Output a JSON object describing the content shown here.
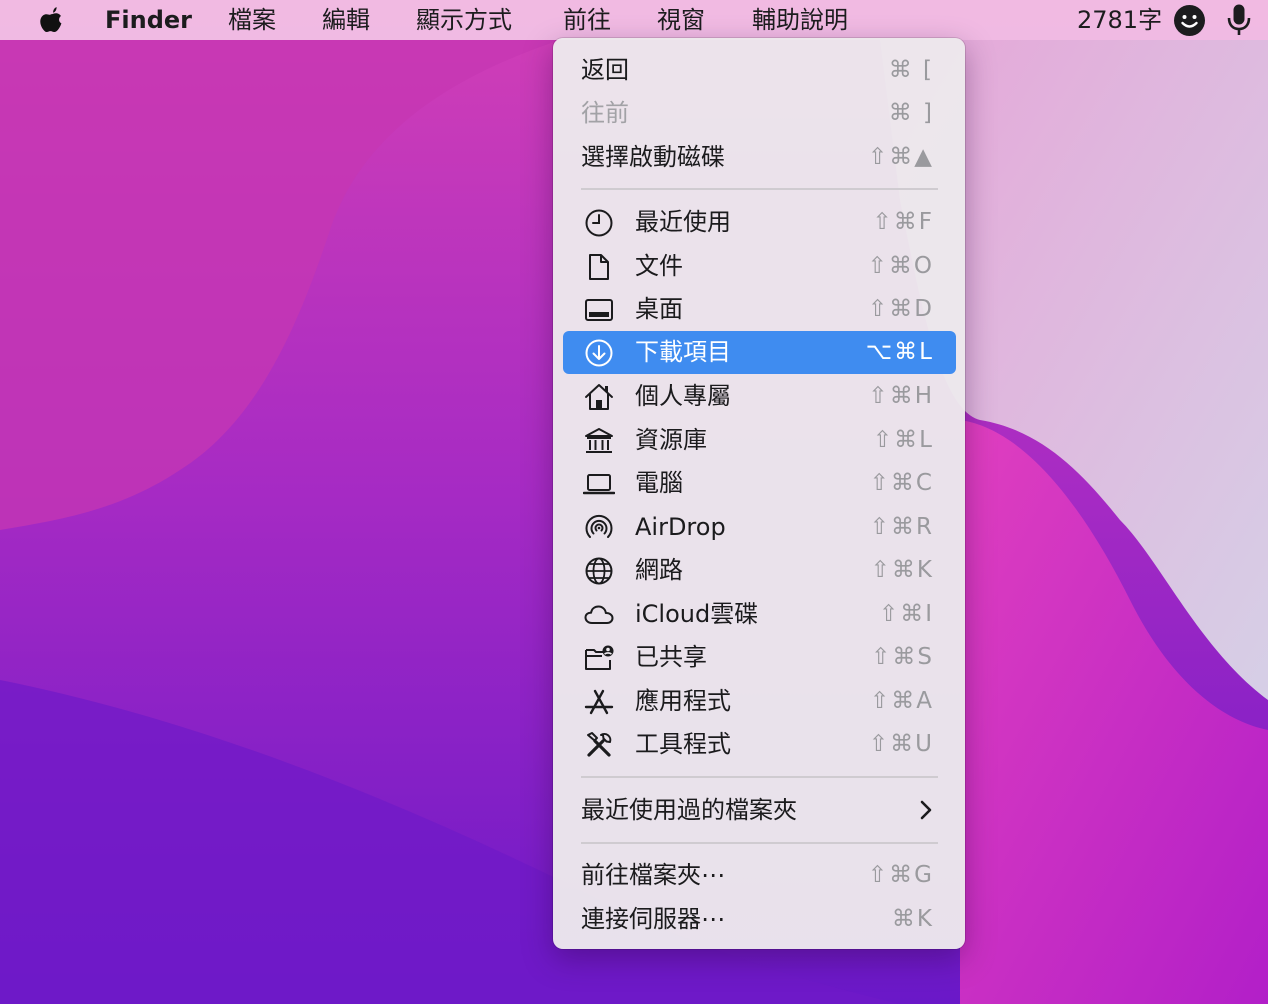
{
  "menubar": {
    "app_name": "Finder",
    "menus": [
      "檔案",
      "編輯",
      "顯示方式",
      "前往",
      "視窗",
      "輔助說明"
    ],
    "status_text": "2781字"
  },
  "go_menu": {
    "top_items": [
      {
        "label": "返回",
        "shortcut": "⌘ [",
        "disabled": false
      },
      {
        "label": "往前",
        "shortcut": "⌘ ]",
        "disabled": true
      },
      {
        "label": "選擇啟動磁碟",
        "shortcut": "⇧⌘▲",
        "disabled": false
      }
    ],
    "locations": [
      {
        "label": "最近使用",
        "shortcut": "⇧⌘F",
        "icon": "clock-icon"
      },
      {
        "label": "文件",
        "shortcut": "⇧⌘O",
        "icon": "document-icon"
      },
      {
        "label": "桌面",
        "shortcut": "⇧⌘D",
        "icon": "desktop-icon"
      },
      {
        "label": "下載項目",
        "shortcut": "⌥⌘L",
        "icon": "download-icon",
        "selected": true
      },
      {
        "label": "個人專屬",
        "shortcut": "⇧⌘H",
        "icon": "home-icon"
      },
      {
        "label": "資源庫",
        "shortcut": "⇧⌘L",
        "icon": "library-icon"
      },
      {
        "label": "電腦",
        "shortcut": "⇧⌘C",
        "icon": "laptop-icon"
      },
      {
        "label": "AirDrop",
        "shortcut": "⇧⌘R",
        "icon": "airdrop-icon"
      },
      {
        "label": "網路",
        "shortcut": "⇧⌘K",
        "icon": "globe-icon"
      },
      {
        "label": "iCloud雲碟",
        "shortcut": "⇧⌘I",
        "icon": "cloud-icon"
      },
      {
        "label": "已共享",
        "shortcut": "⇧⌘S",
        "icon": "shared-folder-icon"
      },
      {
        "label": "應用程式",
        "shortcut": "⇧⌘A",
        "icon": "app-store-icon"
      },
      {
        "label": "工具程式",
        "shortcut": "⇧⌘U",
        "icon": "tools-icon"
      }
    ],
    "recent_folders": {
      "label": "最近使用過的檔案夾"
    },
    "bottom_items": [
      {
        "label": "前往檔案夾⋯",
        "shortcut": "⇧⌘G"
      },
      {
        "label": "連接伺服器⋯",
        "shortcut": "⌘K"
      }
    ]
  }
}
